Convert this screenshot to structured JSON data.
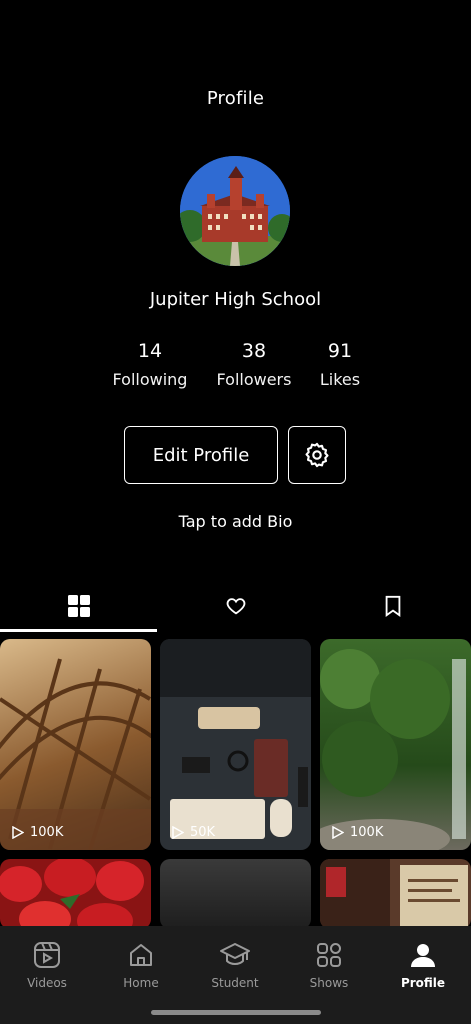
{
  "header": {
    "title": "Profile"
  },
  "profile": {
    "name": "Jupiter High School",
    "stats": [
      {
        "value": "14",
        "label": "Following"
      },
      {
        "value": "38",
        "label": "Followers"
      },
      {
        "value": "91",
        "label": "Likes"
      }
    ],
    "edit_label": "Edit Profile",
    "bio_prompt": "Tap to add Bio"
  },
  "tabs": [
    {
      "icon": "grid-icon",
      "active": true
    },
    {
      "icon": "heart-icon",
      "active": false
    },
    {
      "icon": "bookmark-icon",
      "active": false
    }
  ],
  "videos": [
    {
      "views": "100K"
    },
    {
      "views": "50K"
    },
    {
      "views": "100K"
    },
    {
      "views": ""
    },
    {
      "views": ""
    },
    {
      "views": ""
    }
  ],
  "nav": [
    {
      "label": "Videos",
      "icon": "videos-icon"
    },
    {
      "label": "Home",
      "icon": "home-icon"
    },
    {
      "label": "Student",
      "icon": "graduation-cap-icon"
    },
    {
      "label": "Shows",
      "icon": "shows-icon"
    },
    {
      "label": "Profile",
      "icon": "profile-icon",
      "active": true
    }
  ],
  "colors": {
    "background": "#000000",
    "nav_background": "#1c1c1c",
    "inactive": "#9a9a9a",
    "accent": "#ffffff"
  }
}
